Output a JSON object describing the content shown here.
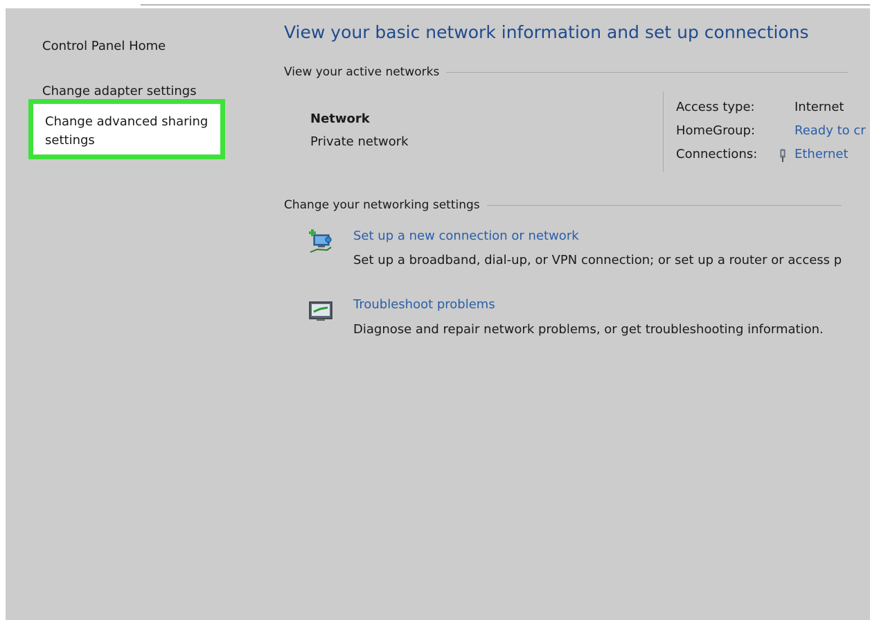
{
  "sidebar": {
    "home": "Control Panel Home",
    "adapter": "Change adapter settings",
    "sharing": "Change advanced sharing settings"
  },
  "main": {
    "title": "View your basic network information and set up connections",
    "active_networks_heading": "View your active networks",
    "network": {
      "name": "Network",
      "type": "Private network",
      "access_type_label": "Access type:",
      "access_type_value": "Internet",
      "homegroup_label": "HomeGroup:",
      "homegroup_value": "Ready to cr",
      "connections_label": "Connections:",
      "connections_value": "Ethernet"
    },
    "change_settings_heading": "Change your networking settings",
    "tasks": [
      {
        "link": "Set up a new connection or network",
        "description": "Set up a broadband, dial-up, or VPN connection; or set up a router or access p",
        "icon": "new-connection-icon"
      },
      {
        "link": "Troubleshoot problems",
        "description": "Diagnose and repair network problems, or get troubleshooting information.",
        "icon": "troubleshoot-icon"
      }
    ]
  },
  "colors": {
    "background": "#cccccc",
    "highlight": "#3fe23a",
    "link": "#2a5ea8",
    "title": "#1f4b8e"
  }
}
